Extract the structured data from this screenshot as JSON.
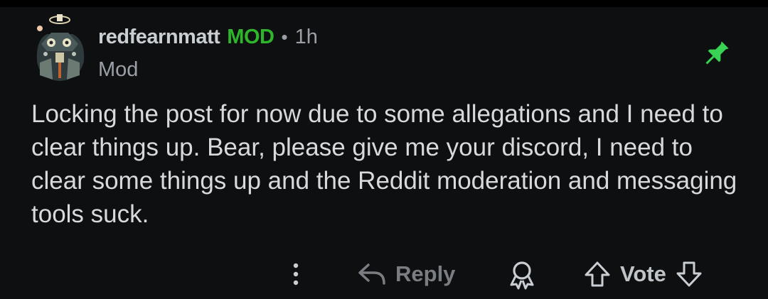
{
  "comment": {
    "username": "redfearnmatt",
    "mod_badge": "MOD",
    "separator": "•",
    "time": "1h",
    "flair": "Mod",
    "body": "Locking the post for now due to some allegations and I need to clear things up. Bear, please give me your discord, I need to clear some things up and the Reddit moderation and messaging tools suck."
  },
  "actions": {
    "reply_label": "Reply",
    "vote_label": "Vote"
  },
  "icons": {
    "pin": "pin-icon",
    "more": "more-vertical-icon",
    "reply": "reply-arrow-icon",
    "award": "award-icon",
    "upvote": "upvote-arrow-icon",
    "downvote": "downvote-arrow-icon"
  },
  "colors": {
    "background": "#0e0f10",
    "mod_green": "#2fb52c",
    "pin_green": "#39d353",
    "text": "#d7dadc",
    "muted": "#9aa0a6"
  }
}
